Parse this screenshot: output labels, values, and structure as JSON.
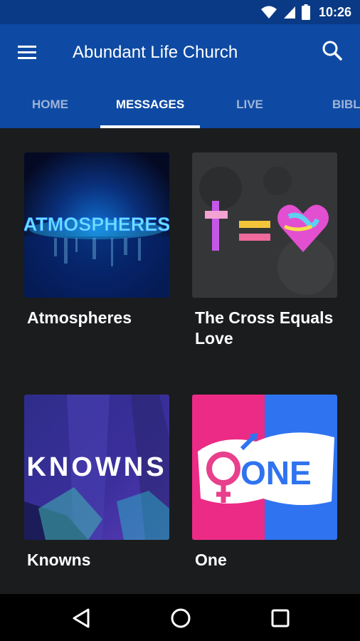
{
  "status": {
    "time": "10:26"
  },
  "app": {
    "title": "Abundant Life Church"
  },
  "tabs": [
    {
      "label": "HOME"
    },
    {
      "label": "MESSAGES"
    },
    {
      "label": "LIVE"
    },
    {
      "label": "BIBLE"
    }
  ],
  "active_tab": "MESSAGES",
  "series": [
    {
      "title": "Atmospheres",
      "artwork_text": "ATMOSPHERES"
    },
    {
      "title": "The Cross Equals Love"
    },
    {
      "title": "Knowns",
      "artwork_text": "KNOWNS"
    },
    {
      "title": "One",
      "artwork_text": "ONE"
    }
  ],
  "colors": {
    "status_bar": "#0a3a85",
    "app_bar": "#0e4aa3",
    "background": "#1b1c1e",
    "tab_inactive": "#9fb4d9"
  },
  "icons": [
    "wifi-icon",
    "signal-icon",
    "battery-icon",
    "menu-icon",
    "search-icon",
    "back-icon",
    "home-icon",
    "recents-icon"
  ]
}
